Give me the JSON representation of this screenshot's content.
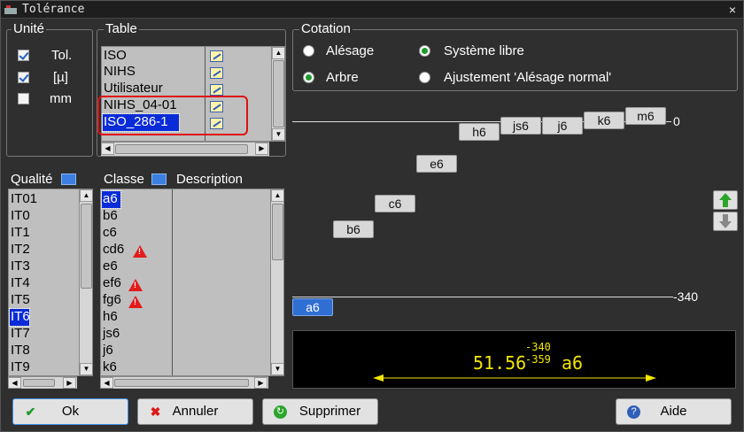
{
  "window": {
    "title": "Tolérance",
    "close": "×"
  },
  "unite": {
    "label": "Unité",
    "options": [
      {
        "label": "Tol.",
        "checked": true
      },
      {
        "label": "[µ]",
        "checked": true
      },
      {
        "label": "mm",
        "checked": false
      }
    ]
  },
  "table": {
    "label": "Table",
    "items": [
      "ISO",
      "NIHS",
      "Utilisateur",
      "NIHS_04-01",
      "ISO_286-1"
    ],
    "selected": "ISO_286-1",
    "highlighted": [
      "NIHS_04-01",
      "ISO_286-1"
    ]
  },
  "cotation": {
    "label": "Cotation",
    "options": [
      {
        "label": "Alésage",
        "selected": false
      },
      {
        "label": "Arbre",
        "selected": true
      },
      {
        "label": "Système libre",
        "selected": true
      },
      {
        "label": "Ajustement 'Alésage normal'",
        "selected": false
      }
    ]
  },
  "qualite": {
    "label": "Qualité",
    "items": [
      "IT01",
      "IT0",
      "IT1",
      "IT2",
      "IT3",
      "IT4",
      "IT5",
      "IT6",
      "IT7",
      "IT8",
      "IT9"
    ],
    "selected": "IT6"
  },
  "classe": {
    "label": "Classe",
    "description_label": "Description",
    "items": [
      {
        "name": "a6",
        "warn": false
      },
      {
        "name": "b6",
        "warn": false
      },
      {
        "name": "c6",
        "warn": false
      },
      {
        "name": "cd6",
        "warn": true
      },
      {
        "name": "e6",
        "warn": false
      },
      {
        "name": "ef6",
        "warn": true
      },
      {
        "name": "fg6",
        "warn": true
      },
      {
        "name": "h6",
        "warn": false
      },
      {
        "name": "js6",
        "warn": false
      },
      {
        "name": "j6",
        "warn": false
      },
      {
        "name": "k6",
        "warn": false
      }
    ],
    "selected": "a6"
  },
  "diagram": {
    "zero_label": "0",
    "bottom_label": "-340",
    "tags": [
      "h6",
      "js6",
      "j6",
      "k6",
      "m6",
      "e6",
      "c6",
      "b6",
      "a6"
    ],
    "active_tag": "a6"
  },
  "result": {
    "nominal": "51.56",
    "upper": "-340",
    "lower": "-359",
    "class": "a6",
    "accent": "#f2e600"
  },
  "buttons": {
    "ok": "Ok",
    "annuler": "Annuler",
    "supprimer": "Supprimer",
    "aide": "Aide"
  },
  "colors": {
    "selection": "#0a2bd8",
    "highlight_box": "#e01010",
    "up_arrow": "#2aa52a"
  }
}
